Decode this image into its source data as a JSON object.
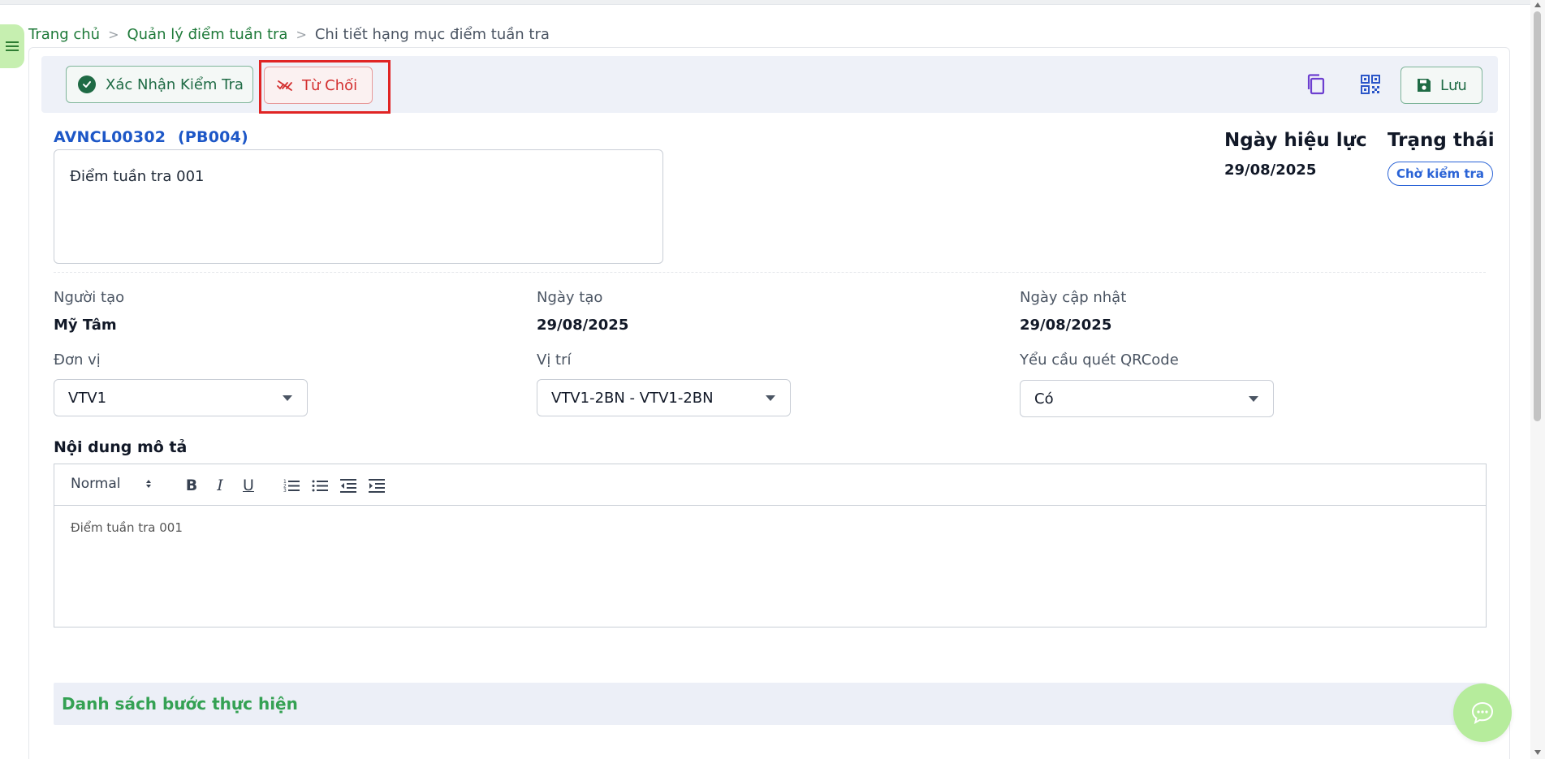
{
  "breadcrumb": {
    "home": "Trang chủ",
    "parent": "Quản lý điểm tuần tra",
    "current": "Chi tiết hạng mục điểm tuần tra",
    "separator": ">"
  },
  "toolbar": {
    "confirm_label": "Xác Nhận Kiểm Tra",
    "reject_label": "Từ Chối",
    "save_label": "Lưu"
  },
  "item": {
    "code": "AVNCL00302",
    "code_suffix": "(PB004)",
    "name": "Điểm tuần tra 001",
    "effective_label": "Ngày hiệu lực",
    "effective_date": "29/08/2025",
    "status_label": "Trạng thái",
    "status": "Chờ kiểm tra"
  },
  "info": {
    "creator_label": "Người tạo",
    "creator": "Mỹ Tâm",
    "created_label": "Ngày tạo",
    "created": "29/08/2025",
    "updated_label": "Ngày cập nhật",
    "updated": "29/08/2025"
  },
  "fields": {
    "unit_label": "Đơn vị",
    "unit": "VTV1",
    "location_label": "Vị trí",
    "location": "VTV1-2BN - VTV1-2BN",
    "qr_label": "Yểu cầu quét QRCode",
    "qr": "Có"
  },
  "description": {
    "label": "Nội dung mô tả",
    "format": "Normal",
    "bold": "B",
    "italic": "I",
    "underline": "U",
    "content": "Điểm tuần tra 001"
  },
  "steps": {
    "title": "Danh sách bước thực hiện"
  },
  "colors": {
    "brand_green": "#1f6b45",
    "link_blue": "#1d57c7",
    "reject_red": "#d32f2f",
    "highlight": "#e02424",
    "steps_green": "#34a153"
  }
}
